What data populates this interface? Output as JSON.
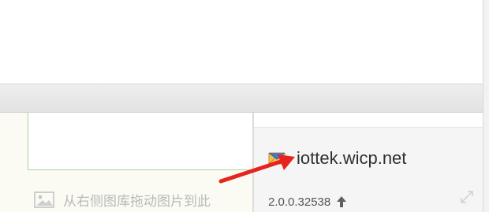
{
  "editor": {
    "image_drop_hint": "从右侧图库拖动图片到此"
  },
  "account_panel": {
    "server_address": "iottek.wicp.net",
    "version": "2.0.0.32538",
    "mail_icon": "mail-envelope-icon",
    "update_icon": "upload-arrow-icon"
  },
  "annotation": {
    "arrow_color": "#e8231f"
  }
}
